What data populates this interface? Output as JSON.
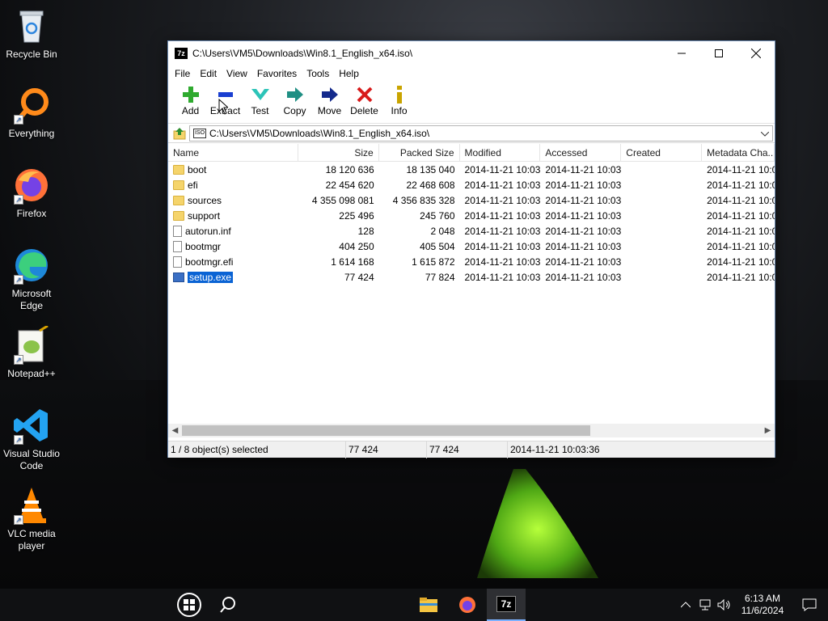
{
  "desktop": {
    "icons": [
      {
        "label": "Recycle Bin",
        "icon": "recycle-bin-icon"
      },
      {
        "label": "Everything",
        "icon": "everything-search-icon"
      },
      {
        "label": "Firefox",
        "icon": "firefox-icon"
      },
      {
        "label": "Microsoft Edge",
        "icon": "edge-icon"
      },
      {
        "label": "Notepad++",
        "icon": "notepad-plus-plus-icon"
      },
      {
        "label": "Visual Studio Code",
        "icon": "vscode-icon"
      },
      {
        "label": "VLC media player",
        "icon": "vlc-icon"
      }
    ]
  },
  "window": {
    "app_icon": "7z",
    "title": "C:\\Users\\VM5\\Downloads\\Win8.1_English_x64.iso\\"
  },
  "menu": [
    "File",
    "Edit",
    "View",
    "Favorites",
    "Tools",
    "Help"
  ],
  "toolbar": {
    "add": "Add",
    "extract": "Extract",
    "test": "Test",
    "copy": "Copy",
    "move": "Move",
    "delete": "Delete",
    "info": "Info"
  },
  "address": {
    "path": "C:\\Users\\VM5\\Downloads\\Win8.1_English_x64.iso\\",
    "badge": "ISO"
  },
  "columns": {
    "name": "Name",
    "size": "Size",
    "packed": "Packed Size",
    "modified": "Modified",
    "accessed": "Accessed",
    "created": "Created",
    "metadata": "Metadata Cha..."
  },
  "files": [
    {
      "name": "boot",
      "type": "folder",
      "size": "18 120 636",
      "packed": "18 135 040",
      "modified": "2014-11-21 10:03",
      "accessed": "2014-11-21 10:03",
      "created": "",
      "metadata": "2014-11-21 10:0"
    },
    {
      "name": "efi",
      "type": "folder",
      "size": "22 454 620",
      "packed": "22 468 608",
      "modified": "2014-11-21 10:03",
      "accessed": "2014-11-21 10:03",
      "created": "",
      "metadata": "2014-11-21 10:0"
    },
    {
      "name": "sources",
      "type": "folder",
      "size": "4 355 098 081",
      "packed": "4 356 835 328",
      "modified": "2014-11-21 10:03",
      "accessed": "2014-11-21 10:03",
      "created": "",
      "metadata": "2014-11-21 10:0"
    },
    {
      "name": "support",
      "type": "folder",
      "size": "225 496",
      "packed": "245 760",
      "modified": "2014-11-21 10:03",
      "accessed": "2014-11-21 10:03",
      "created": "",
      "metadata": "2014-11-21 10:0"
    },
    {
      "name": "autorun.inf",
      "type": "file",
      "size": "128",
      "packed": "2 048",
      "modified": "2014-11-21 10:03",
      "accessed": "2014-11-21 10:03",
      "created": "",
      "metadata": "2014-11-21 10:0"
    },
    {
      "name": "bootmgr",
      "type": "file",
      "size": "404 250",
      "packed": "405 504",
      "modified": "2014-11-21 10:03",
      "accessed": "2014-11-21 10:03",
      "created": "",
      "metadata": "2014-11-21 10:0"
    },
    {
      "name": "bootmgr.efi",
      "type": "file",
      "size": "1 614 168",
      "packed": "1 615 872",
      "modified": "2014-11-21 10:03",
      "accessed": "2014-11-21 10:03",
      "created": "",
      "metadata": "2014-11-21 10:0"
    },
    {
      "name": "setup.exe",
      "type": "exe",
      "size": "77 424",
      "packed": "77 824",
      "modified": "2014-11-21 10:03",
      "accessed": "2014-11-21 10:03",
      "created": "",
      "metadata": "2014-11-21 10:0",
      "selected": true
    }
  ],
  "status": {
    "selection": "1 / 8 object(s) selected",
    "size": "77 424",
    "packed": "77 424",
    "modified": "2014-11-21 10:03:36"
  },
  "taskbar": {
    "time": "6:13 AM",
    "date": "11/6/2024",
    "seven_zip_label": "7z"
  },
  "colors": {
    "selection": "#0a63d4",
    "folder": "#f5d46b",
    "taskbar": "#101113"
  }
}
